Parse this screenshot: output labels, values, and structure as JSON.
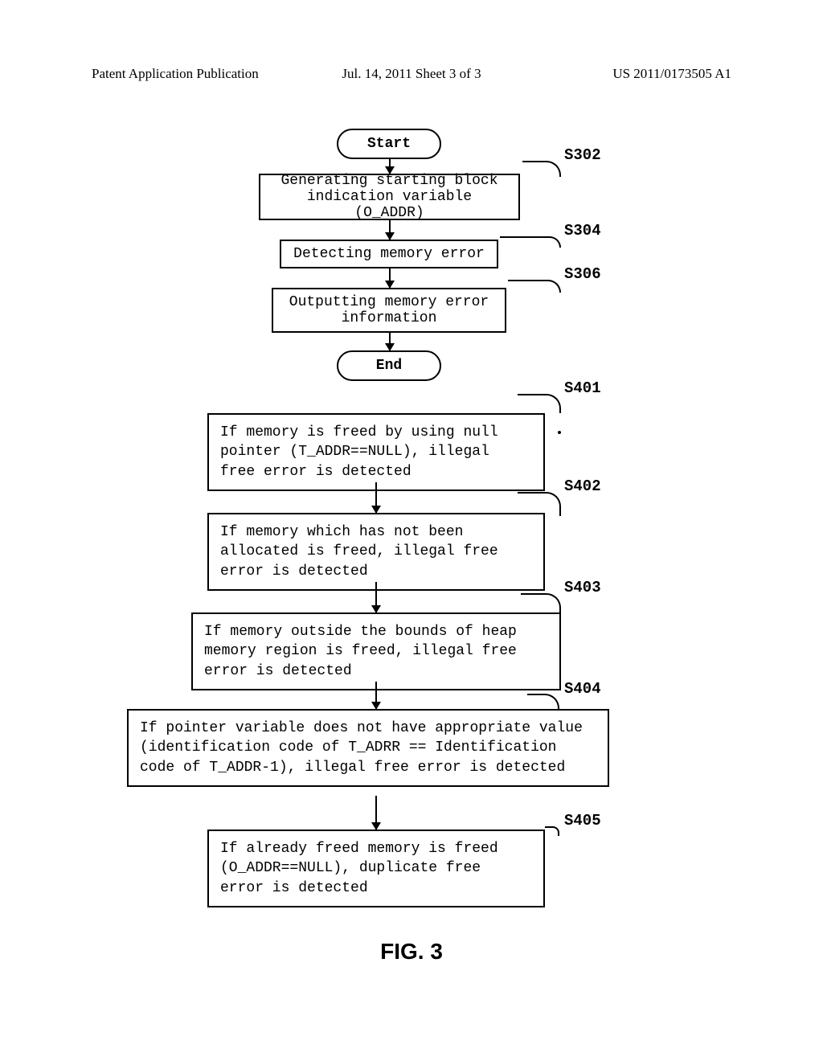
{
  "header": {
    "left": "Patent Application Publication",
    "center": "Jul. 14, 2011  Sheet 3 of 3",
    "right": "US 2011/0173505 A1"
  },
  "flowchart": {
    "start": "Start",
    "end": "End",
    "step302": {
      "text": "Generating starting block\nindication variable (O_ADDR)",
      "label": "S302"
    },
    "step304": {
      "text": "Detecting memory error",
      "label": "S304"
    },
    "step306": {
      "text": "Outputting memory error\ninformation",
      "label": "S306"
    },
    "step401": {
      "text": "If memory is freed by using null pointer (T_ADDR==NULL), illegal free error is detected",
      "label": "S401"
    },
    "step402": {
      "text": "If memory which has not been allocated is freed, illegal free error is detected",
      "label": "S402"
    },
    "step403": {
      "text": "If memory outside the bounds of heap memory region is freed, illegal free error is detected",
      "label": "S403"
    },
    "step404": {
      "text": "If pointer variable does not have appropriate value (identification code of T_ADRR == Identification code of T_ADDR-1), illegal free error is detected",
      "label": "S404"
    },
    "step405": {
      "text": "If already freed memory is freed (O_ADDR==NULL), duplicate free error is detected",
      "label": "S405"
    }
  },
  "figure_label": "FIG. 3"
}
